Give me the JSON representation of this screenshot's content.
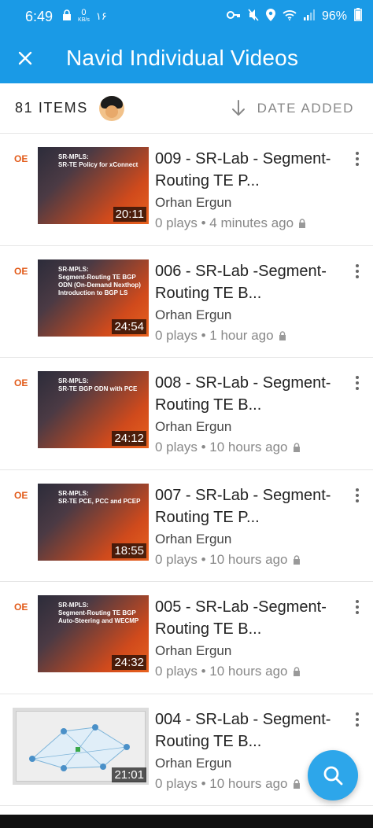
{
  "status_bar": {
    "time": "6:49",
    "net_speed_value": "0",
    "net_speed_unit": "KB/s",
    "extra_text": "۱۶",
    "battery": "96%"
  },
  "app_bar": {
    "title": "Navid Individual Videos",
    "close_icon": "close-icon"
  },
  "sub_bar": {
    "count_label": "81 ITEMS",
    "sort_label": "DATE ADDED",
    "sort_icon": "arrow-down-icon"
  },
  "videos": [
    {
      "title": "009 - SR-Lab - Segment-Routing TE P...",
      "channel": "Orhan Ergun",
      "meta": "0 plays • 4 minutes ago",
      "duration": "20:11",
      "thumb_text": "SR-MPLS:\nSR-TE Policy for xConnect"
    },
    {
      "title": "006 - SR-Lab -Segment-Routing TE B...",
      "channel": "Orhan Ergun",
      "meta": "0 plays • 1 hour ago",
      "duration": "24:54",
      "thumb_text": "SR-MPLS:\nSegment-Routing TE BGP ODN (On-Demand Nexthop) Introduction to BGP LS"
    },
    {
      "title": "008 - SR-Lab - Segment-Routing TE B...",
      "channel": "Orhan Ergun",
      "meta": "0 plays • 10 hours ago",
      "duration": "24:12",
      "thumb_text": "SR-MPLS:\nSR-TE BGP ODN with PCE"
    },
    {
      "title": "007 - SR-Lab - Segment-Routing TE P...",
      "channel": "Orhan Ergun",
      "meta": "0 plays • 10 hours ago",
      "duration": "18:55",
      "thumb_text": "SR-MPLS:\nSR-TE PCE, PCC and PCEP"
    },
    {
      "title": "005 - SR-Lab -Segment-Routing TE B...",
      "channel": "Orhan Ergun",
      "meta": "0 plays • 10 hours ago",
      "duration": "24:32",
      "thumb_text": "SR-MPLS:\nSegment-Routing TE BGP Auto-Steering and WECMP"
    },
    {
      "title": "004 - SR-Lab - Segment-Routing TE B...",
      "channel": "Orhan Ergun",
      "meta": "0 plays • 10 hours ago",
      "duration": "21:01",
      "thumb_text": ""
    }
  ],
  "fab": {
    "icon": "search-icon"
  },
  "colors": {
    "brand_blue": "#1a9ae6",
    "fab_blue": "#2da6ea",
    "slide_orange": "#e8621e"
  }
}
